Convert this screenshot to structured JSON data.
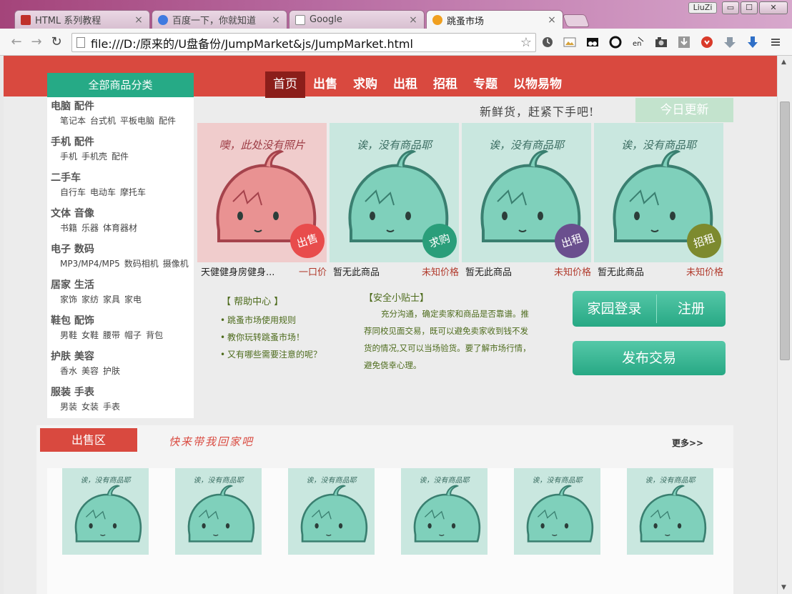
{
  "browser": {
    "tabs": [
      {
        "label": "HTML 系列教程",
        "favicon": "w3-icon",
        "color": "#c0302a"
      },
      {
        "label": "百度一下，你就知道",
        "favicon": "baidu-icon",
        "color": "#3f7ae0"
      },
      {
        "label": "Google",
        "favicon": "page-icon",
        "color": "#ffffff"
      },
      {
        "label": "跳蚤市场",
        "favicon": "chrome-page-icon",
        "color": "#f0a020"
      }
    ],
    "tab_close": "×",
    "user_badge": "LiuZi",
    "window_controls": {
      "minimize": "▭",
      "maximize": "☐",
      "close": "✕"
    },
    "url": "file:///D:/原来的/U盘备份/JumpMarket&js/JumpMarket.html",
    "nav": {
      "back": "←",
      "forward": "→",
      "reload": "↻",
      "star": "☆"
    }
  },
  "page": {
    "category_header": "全部商品分类",
    "categories": [
      {
        "title": "电脑 配件",
        "subs": [
          "笔记本",
          "台式机",
          "平板电脑",
          "配件"
        ]
      },
      {
        "title": "手机 配件",
        "subs": [
          "手机",
          "手机壳",
          "配件"
        ]
      },
      {
        "title": "二手车",
        "subs": [
          "自行车",
          "电动车",
          "摩托车"
        ]
      },
      {
        "title": "文体 音像",
        "subs": [
          "书籍",
          "乐器",
          "体育器材"
        ]
      },
      {
        "title": "电子 数码",
        "subs": [
          "MP3/MP4/MP5",
          "数码相机",
          "摄像机"
        ]
      },
      {
        "title": "居家 生活",
        "subs": [
          "家饰",
          "家纺",
          "家具",
          "家电"
        ]
      },
      {
        "title": "鞋包 配饰",
        "subs": [
          "男鞋",
          "女鞋",
          "腰带",
          "帽子",
          "背包"
        ]
      },
      {
        "title": "护肤 美容",
        "subs": [
          "香水",
          "美容",
          "护肤"
        ]
      },
      {
        "title": "服装 手表",
        "subs": [
          "男装",
          "女装",
          "手表"
        ]
      }
    ],
    "nav": [
      "首页",
      "出售",
      "求购",
      "出租",
      "招租",
      "专题",
      "以物易物"
    ],
    "slogan": "新鲜货，赶紧下手吧!",
    "today_update": "今日更新",
    "products": [
      {
        "name": "天健健身房健身...",
        "price": "一口价",
        "badge": "出售",
        "badge_color": "#e84c4c",
        "caption": "噢，此处没有照片",
        "bg": "#f0cccc"
      },
      {
        "name": "暂无此商品",
        "price": "未知价格",
        "badge": "求购",
        "badge_color": "#2a9e7a",
        "caption": "诶，没有商品耶",
        "bg": "#c9e7df"
      },
      {
        "name": "暂无此商品",
        "price": "未知价格",
        "badge": "出租",
        "badge_color": "#6a4f8e",
        "caption": "诶，没有商品耶",
        "bg": "#c9e7df"
      },
      {
        "name": "暂无此商品",
        "price": "未知价格",
        "badge": "招租",
        "badge_color": "#7d8a2e",
        "caption": "诶，没有商品耶",
        "bg": "#c9e7df"
      }
    ],
    "help": {
      "title": "【 帮助中心 】",
      "items": [
        "跳蚤市场使用规则",
        "教你玩转跳蚤市场！",
        "又有哪些需要注意的呢？"
      ]
    },
    "tips": {
      "title": "【安全小贴士】",
      "body": "充分沟通，确定卖家和商品是否靠谱。推荐同校见面交易，既可以避免卖家收到钱不发货的情况,又可以当场验货。要了解市场行情，避免侥幸心理。"
    },
    "login": "家园登录",
    "register": "注册",
    "publish": "发布交易",
    "sale": {
      "tag": "出售区",
      "slogan": "快来带我回家吧",
      "more": "更多>>",
      "items": [
        {
          "caption": "诶，没有商品耶"
        },
        {
          "caption": "诶，没有商品耶"
        },
        {
          "caption": "诶，没有商品耶"
        },
        {
          "caption": "诶，没有商品耶"
        },
        {
          "caption": "诶，没有商品耶"
        },
        {
          "caption": "诶，没有商品耶"
        }
      ]
    }
  }
}
